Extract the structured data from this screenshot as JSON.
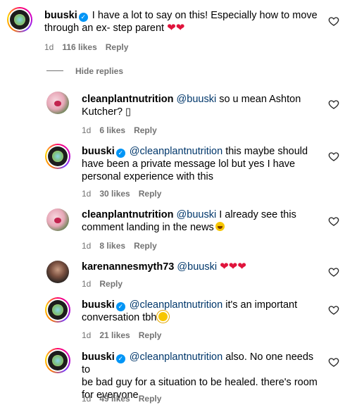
{
  "comment": {
    "username": "buuski",
    "text": "I have a lot to say on this! Especially how to move through an ex- step parent",
    "hearts": "❤❤",
    "age": "1d",
    "likes": "116 likes",
    "reply_label": "Reply"
  },
  "hide_replies_label": "Hide replies",
  "replies": [
    {
      "username": "cleanplantnutrition",
      "mention": "@buuski",
      "text_line1": " so u mean Ashton",
      "text_line2": "Kutcher? ▯",
      "age": "1d",
      "likes": "6 likes",
      "reply_label": "Reply"
    },
    {
      "username": "buuski",
      "mention": "@cleanplantnutrition",
      "text_line1": " this maybe should",
      "text_line2": "have been a private message lol but yes I have",
      "text_line3": "personal experience with this",
      "age": "1d",
      "likes": "30 likes",
      "reply_label": "Reply"
    },
    {
      "username": "cleanplantnutrition",
      "mention": "@buuski",
      "text_line1": " I already see this",
      "text_line2": "comment landing in the news",
      "age": "1d",
      "likes": "8 likes",
      "reply_label": "Reply"
    },
    {
      "username": "karenannesmyth73",
      "mention": "@buuski",
      "hearts": "❤❤❤",
      "age": "1d",
      "reply_label": "Reply"
    },
    {
      "username": "buuski",
      "mention": "@cleanplantnutrition",
      "text_line1": " it's an important",
      "text_line2": "conversation tbh",
      "age": "1d",
      "likes": "21 likes",
      "reply_label": "Reply"
    },
    {
      "username": "buuski",
      "mention": "@cleanplantnutrition",
      "text_line1": " also. No one needs to",
      "text_line2": "be bad guy for a situation to be healed. there's room",
      "text_line3": "for everyone",
      "age": "1d",
      "likes": "49 likes",
      "reply_label": "Reply"
    }
  ],
  "colors": {
    "mention": "#00376b",
    "meta": "#737373",
    "verified": "#0095f6"
  },
  "icons": {
    "like": "heart-outline-icon",
    "verified": "verified-badge-icon"
  }
}
